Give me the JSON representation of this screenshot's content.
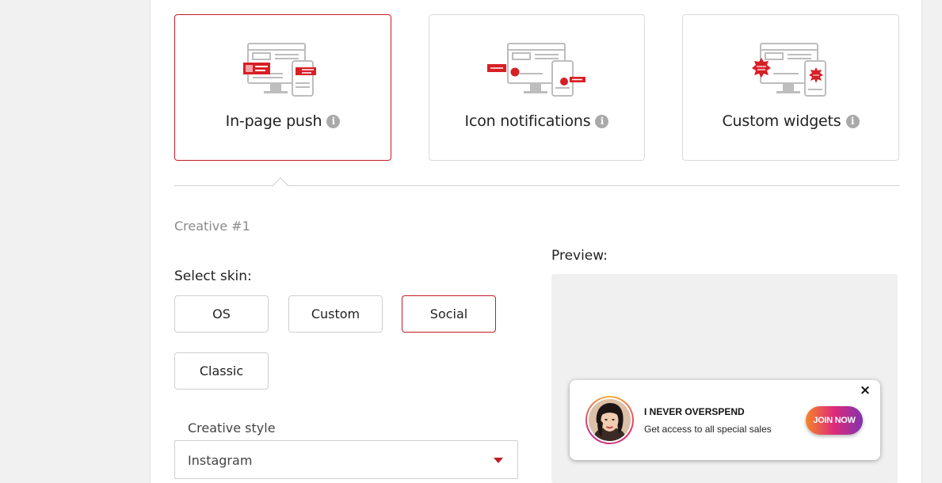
{
  "formats": [
    {
      "label": "In-page push",
      "selected": true,
      "illustration": "in-page-push-illustration"
    },
    {
      "label": "Icon notifications",
      "selected": false,
      "illustration": "icon-notifications-illustration"
    },
    {
      "label": "Custom widgets",
      "selected": false,
      "illustration": "custom-widgets-illustration"
    }
  ],
  "creative": {
    "title": "Creative #1",
    "skin_label": "Select skin:",
    "skins": [
      "OS",
      "Custom",
      "Social",
      "Classic"
    ],
    "selected_skin": "Social",
    "style_label": "Creative style",
    "style_value": "Instagram"
  },
  "preview": {
    "label": "Preview:",
    "notification": {
      "title": "I NEVER OVERSPEND",
      "text": "Get access to all special sales",
      "button": "JOIN NOW",
      "close": "×"
    }
  },
  "colors": {
    "accent": "#c21d25",
    "border": "#cfcfcf",
    "illustration_gray": "#bdbdbd",
    "illustration_red": "#d81f26"
  },
  "icons": [
    "info-icon",
    "close-icon",
    "caret-down-icon"
  ]
}
